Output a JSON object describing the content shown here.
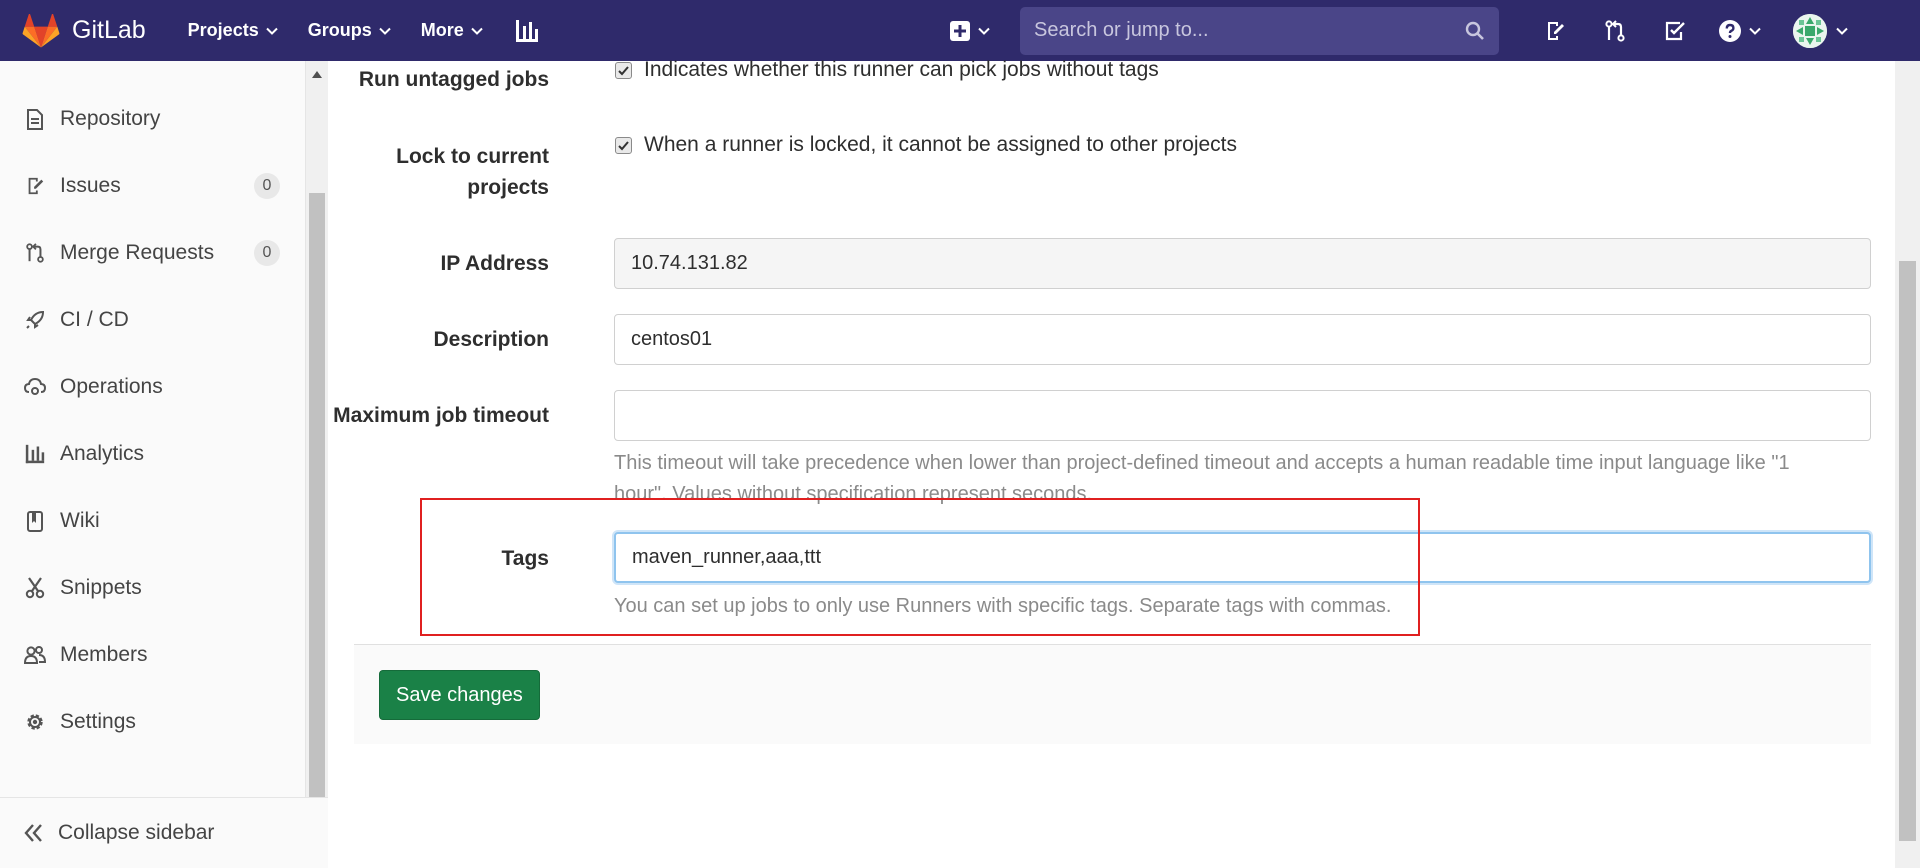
{
  "navbar": {
    "brand": "GitLab",
    "menus": [
      {
        "label": "Projects"
      },
      {
        "label": "Groups"
      },
      {
        "label": "More"
      }
    ],
    "search_placeholder": "Search or jump to...",
    "colors": {
      "background": "#2f2a6b",
      "search_bg": "#4a4588"
    }
  },
  "sidebar": {
    "items": [
      {
        "label": "Repository",
        "icon": "document-icon"
      },
      {
        "label": "Issues",
        "icon": "issues-icon",
        "count": "0"
      },
      {
        "label": "Merge Requests",
        "icon": "merge-request-icon",
        "count": "0"
      },
      {
        "label": "CI / CD",
        "icon": "rocket-icon"
      },
      {
        "label": "Operations",
        "icon": "cloud-gear-icon"
      },
      {
        "label": "Analytics",
        "icon": "chart-icon"
      },
      {
        "label": "Wiki",
        "icon": "book-icon"
      },
      {
        "label": "Snippets",
        "icon": "scissors-icon"
      },
      {
        "label": "Members",
        "icon": "users-icon"
      },
      {
        "label": "Settings",
        "icon": "gear-icon"
      }
    ],
    "collapse_label": "Collapse sidebar"
  },
  "form": {
    "run_untagged": {
      "label": "Run untagged jobs",
      "checked": true,
      "text": "Indicates whether this runner can pick jobs without tags"
    },
    "lock": {
      "label_line1": "Lock to current",
      "label_line2": "projects",
      "checked": true,
      "text": "When a runner is locked, it cannot be assigned to other projects"
    },
    "ip": {
      "label": "IP Address",
      "value": "10.74.131.82"
    },
    "description": {
      "label": "Description",
      "value": "centos01"
    },
    "timeout": {
      "label": "Maximum job timeout",
      "value": "",
      "help_line1": "This timeout will take precedence when lower than project-defined timeout and accepts a human readable time input language like \"1",
      "help_line2": "hour\". Values without specification represent seconds."
    },
    "tags": {
      "label": "Tags",
      "value": "maven_runner,aaa,ttt",
      "help": "You can set up jobs to only use Runners with specific tags. Separate tags with commas."
    },
    "save_label": "Save changes",
    "colors": {
      "save_button": "#1a8147",
      "highlight_box": "#e02020"
    }
  }
}
